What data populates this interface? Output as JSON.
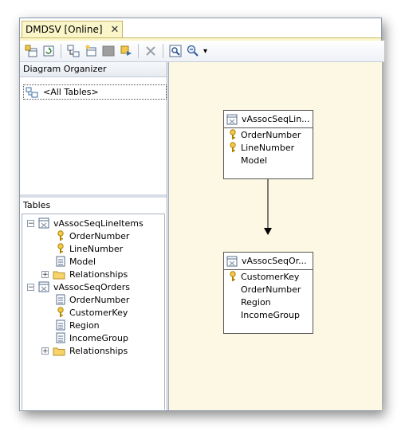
{
  "tab": {
    "title": "DMDSV [Online]",
    "close": "✕"
  },
  "toolbar": {
    "buttons": [
      "add-table-icon",
      "refresh-icon",
      "new-relationship-icon",
      "new-named-query-icon",
      "toggle-pane-icon",
      "show-related-icon",
      "delete-icon",
      "zoom-to-fit-icon",
      "zoom-icon"
    ],
    "dropdown_arrow": "▾"
  },
  "organizer": {
    "title": "Diagram Organizer",
    "item": "<All Tables>"
  },
  "tables_panel": {
    "title": "Tables",
    "expand_symbol": "⊟",
    "collapse_symbol": "⊞",
    "tree": [
      {
        "name": "vAssocSeqLineItems",
        "columns": [
          {
            "label": "OrderNumber",
            "key": true
          },
          {
            "label": "LineNumber",
            "key": true
          },
          {
            "label": "Model",
            "key": false
          }
        ],
        "relationships": "Relationships"
      },
      {
        "name": "vAssocSeqOrders",
        "columns": [
          {
            "label": "OrderNumber",
            "key": false
          },
          {
            "label": "CustomerKey",
            "key": true
          },
          {
            "label": "Region",
            "key": false
          },
          {
            "label": "IncomeGroup",
            "key": false
          }
        ],
        "relationships": "Relationships"
      }
    ]
  },
  "diagram": {
    "table1": {
      "title": "vAssocSeqLin...",
      "columns": [
        "OrderNumber",
        "LineNumber",
        "Model"
      ],
      "keys": [
        true,
        true,
        false
      ]
    },
    "table2": {
      "title": "vAssocSeqOr...",
      "columns": [
        "CustomerKey",
        "OrderNumber",
        "Region",
        "IncomeGroup"
      ],
      "keys": [
        true,
        false,
        false,
        false
      ]
    }
  },
  "colors": {
    "canvas": "#fdf8e4",
    "tab": "#fbf6c9",
    "key": "#e0a800"
  }
}
